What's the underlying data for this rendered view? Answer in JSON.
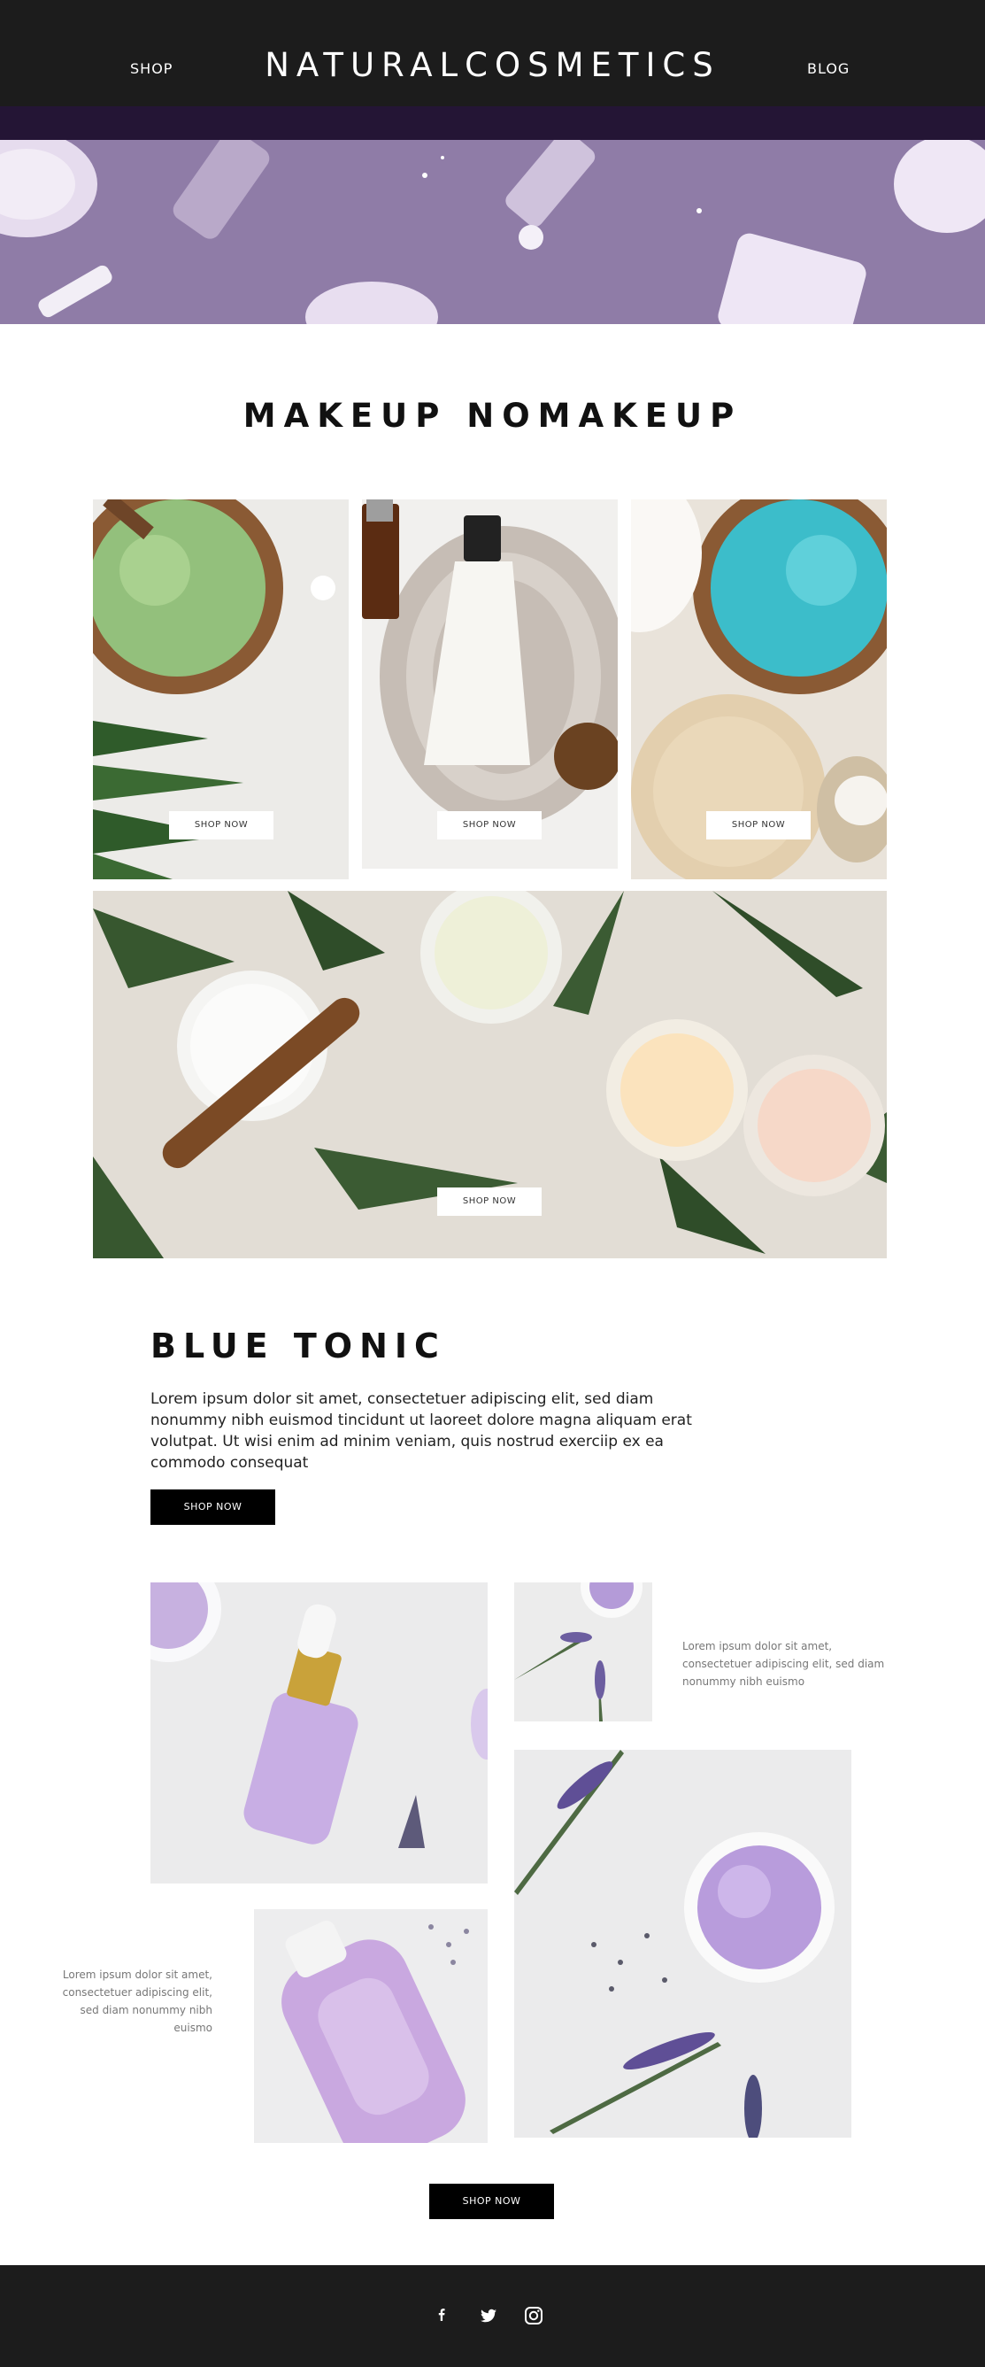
{
  "header": {
    "brand": "NATURALCOSMETICS",
    "nav_shop": "SHOP",
    "nav_blog": "BLOG"
  },
  "section_makeup": {
    "title": "MAKEUP NOMAKEUP",
    "tiles": [
      {
        "button": "SHOP NOW"
      },
      {
        "button": "SHOP NOW"
      },
      {
        "button": "SHOP NOW"
      },
      {
        "button": "SHOP NOW"
      }
    ]
  },
  "section_blue": {
    "title": "BLUE TONIC",
    "body": "Lorem ipsum dolor sit amet, consectetuer adipiscing elit, sed diam nonummy nibh euismod tincidunt ut laoreet dolore magna aliquam erat volutpat. Ut wisi enim ad minim veniam, quis nostrud exerciip ex ea commodo consequat",
    "button": "SHOP NOW"
  },
  "gallery": {
    "caption_right": "Lorem ipsum dolor sit amet, consectetuer adipiscing elit, sed diam nonummy nibh euismo",
    "caption_left": "Lorem ipsum dolor sit amet, consectetuer adipiscing elit, sed diam nonummy nibh euismo",
    "button": "SHOP NOW"
  },
  "footer": {
    "icons": [
      "facebook-icon",
      "twitter-icon",
      "instagram-icon"
    ]
  },
  "colors": {
    "header_bg": "#1c1c1c",
    "accent_band": "#241535",
    "hero_bg": "#8f7ca7",
    "button_bg": "#000000"
  }
}
